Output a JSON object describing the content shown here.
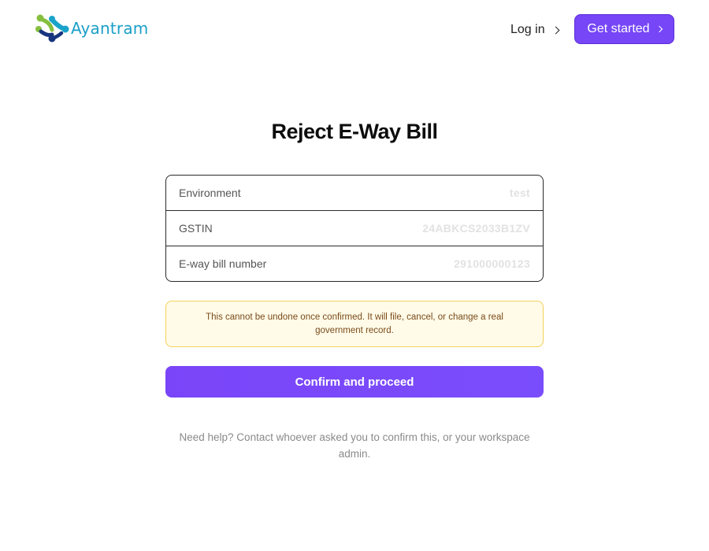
{
  "brand": {
    "logo_icon": "ayantram-logo-icon",
    "name": "Ayantram",
    "color": "#1a9fc9"
  },
  "header": {
    "login_label": "Log in",
    "get_started_label": "Get started",
    "accent_color": "#7646f7"
  },
  "main": {
    "title": "Reject E-Way Bill",
    "fields": [
      {
        "label": "Environment",
        "value": "test"
      },
      {
        "label": "GSTIN",
        "value": "24ABKCS2033B1ZV"
      },
      {
        "label": "E-way bill number",
        "value": "291000000123"
      }
    ],
    "warning": "This cannot be undone once confirmed. It will file, cancel, or change a real government record.",
    "confirm_label": "Confirm and proceed",
    "help_text": "Need help? Contact whoever asked you to confirm this, or your workspace admin."
  }
}
